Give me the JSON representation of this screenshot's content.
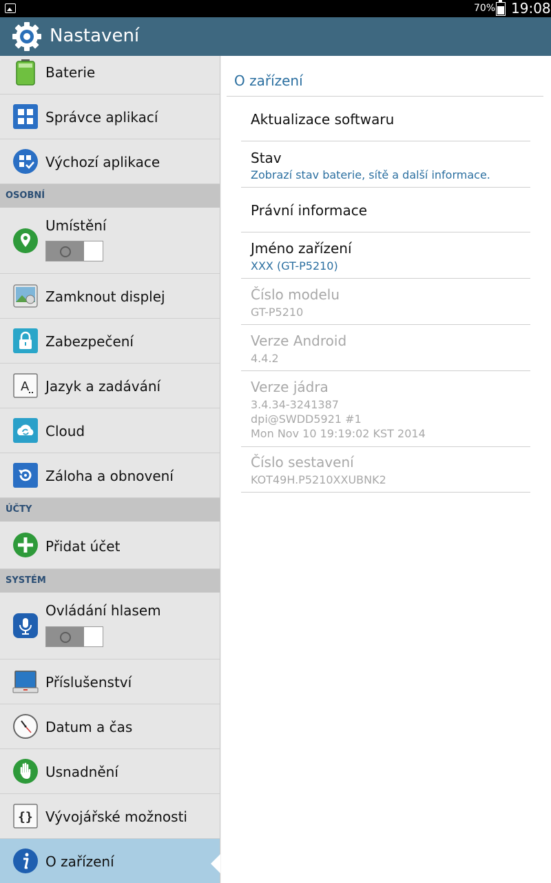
{
  "status_bar": {
    "battery_percent": "70%",
    "time": "19:08"
  },
  "action_bar": {
    "title": "Nastavení"
  },
  "sidebar": {
    "items": [
      {
        "label": "Baterie"
      },
      {
        "label": "Správce aplikací"
      },
      {
        "label": "Výchozí aplikace"
      },
      {
        "label": "Umístění"
      },
      {
        "label": "Zamknout displej"
      },
      {
        "label": "Zabezpečení"
      },
      {
        "label": "Jazyk a zadávání"
      },
      {
        "label": "Cloud"
      },
      {
        "label": "Záloha a obnovení"
      },
      {
        "label": "Přidat účet"
      },
      {
        "label": "Ovládání hlasem"
      },
      {
        "label": "Příslušenství"
      },
      {
        "label": "Datum a čas"
      },
      {
        "label": "Usnadnění"
      },
      {
        "label": "Vývojářské možnosti"
      },
      {
        "label": "O zařízení"
      }
    ],
    "sections": {
      "personal": "OSOBNÍ",
      "accounts": "ÚČTY",
      "system": "SYSTÉM"
    },
    "toggles": {
      "location": "off",
      "voice_control": "off"
    },
    "selected_item": "O zařízení"
  },
  "detail": {
    "title": "O zařízení",
    "items": [
      {
        "title": "Aktualizace softwaru"
      },
      {
        "title": "Stav",
        "summary": "Zobrazí stav baterie, sítě a další informace."
      },
      {
        "title": "Právní informace"
      },
      {
        "title": "Jméno zařízení",
        "summary": "XXX (GT-P5210)"
      },
      {
        "title": "Číslo modelu",
        "summary": "GT-P5210"
      },
      {
        "title": "Verze Android",
        "summary": "4.4.2"
      },
      {
        "title": "Verze jádra",
        "summary_lines": [
          "3.4.34-3241387",
          "dpi@SWDD5921 #1",
          "Mon Nov 10 19:19:02 KST 2014"
        ]
      },
      {
        "title": "Číslo sestavení",
        "summary": "KOT49H.P5210XXUBNK2"
      }
    ]
  },
  "colors": {
    "action_bar": "#3e6880",
    "accent": "#2b6fa0",
    "selected": "#a9cde3"
  }
}
